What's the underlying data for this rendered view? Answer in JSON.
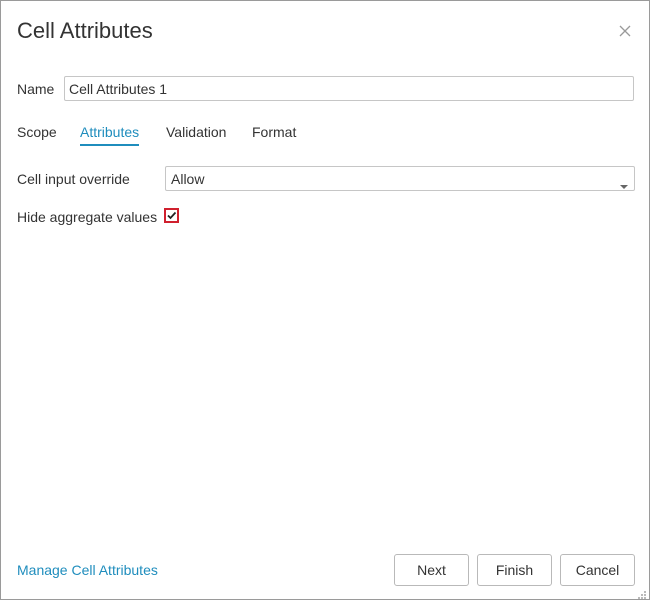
{
  "dialog": {
    "title": "Cell Attributes",
    "close_icon": "close-icon"
  },
  "name": {
    "label": "Name",
    "value": "Cell Attributes 1"
  },
  "tabs": [
    {
      "label": "Scope",
      "active": false
    },
    {
      "label": "Attributes",
      "active": true
    },
    {
      "label": "Validation",
      "active": false
    },
    {
      "label": "Format",
      "active": false
    }
  ],
  "attributes": {
    "cell_input_override": {
      "label": "Cell input override",
      "value": "Allow",
      "caret_icon": "caret-down-icon"
    },
    "hide_aggregate": {
      "label": "Hide aggregate values",
      "checked": true,
      "icon": "checkmark-icon"
    }
  },
  "footer": {
    "manage_link": "Manage Cell Attributes",
    "next": "Next",
    "finish": "Finish",
    "cancel": "Cancel",
    "resize_icon": "resize-grip-icon"
  },
  "colors": {
    "accent": "#1f8dbd",
    "checkbox_border": "#d0202e",
    "text": "#333333"
  }
}
